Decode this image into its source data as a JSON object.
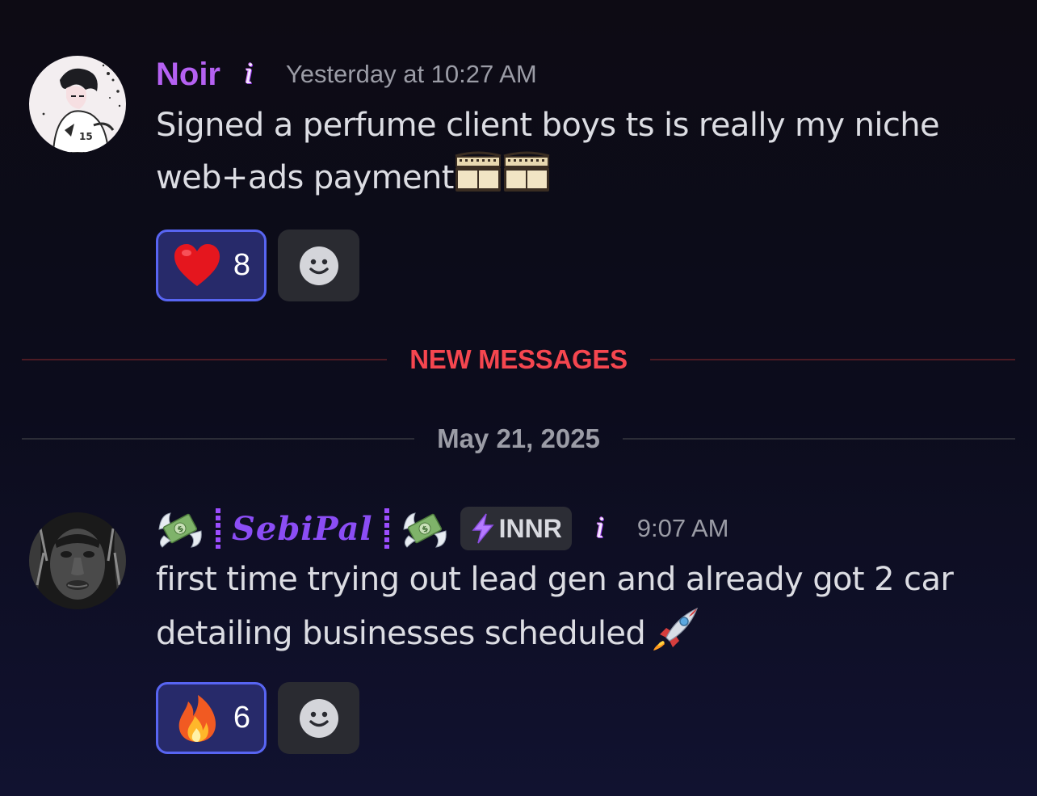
{
  "messages": [
    {
      "username": "Noir",
      "username_color": "#b561f2",
      "timestamp": "Yesterday at 10:27 AM",
      "info_badge": "i",
      "text_line1": "Signed a perfume client boys ts is really my niche",
      "text_line2": "web+ads payment",
      "trailing_emojis": [
        "film-frames",
        "film-frames"
      ],
      "reactions": [
        {
          "emoji": "red-heart",
          "count": "8",
          "active": true
        }
      ],
      "add_reaction_icon": "smiley-add-reaction-icon"
    },
    {
      "username": "SebiPal",
      "username_color": "#8b4df5",
      "name_decorations": [
        "money-with-wings",
        "money-with-wings"
      ],
      "role_tag": "INNR",
      "role_tag_icon": "lightning-bolt",
      "info_badge": "i",
      "timestamp": "9:07 AM",
      "text_line1": "first time trying out lead gen and already got 2 car",
      "text_line2": "detailing businesses scheduled",
      "trailing_emoji": "rocket",
      "reactions": [
        {
          "emoji": "fire",
          "count": "6",
          "active": true
        }
      ],
      "add_reaction_icon": "smiley-add-reaction-icon"
    }
  ],
  "new_messages_divider": {
    "label": "NEW MESSAGES",
    "color": "#f5464f"
  },
  "date_divider": {
    "label": "May 21, 2025"
  },
  "theme": {
    "background": "#0c0c1c",
    "reaction_active_bg": "#272a6a",
    "reaction_active_border": "#5865f2",
    "reaction_add_bg": "#2a2b31"
  }
}
